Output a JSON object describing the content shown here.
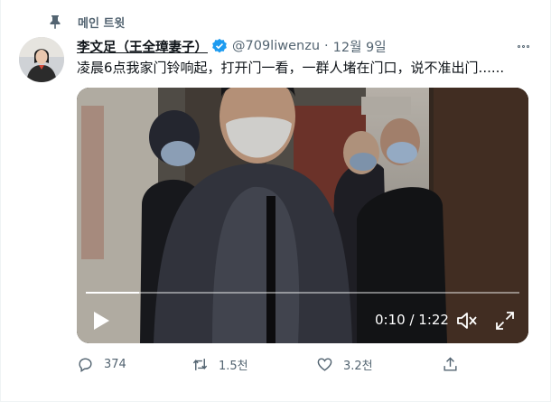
{
  "pinned": {
    "label": "메인 트윗",
    "icon": "pin-icon"
  },
  "author": {
    "display_name": "李文足（王全璋妻子）",
    "handle": "@709liwenzu",
    "separator": "·",
    "date": "12월 9일",
    "verified": true,
    "verified_icon": "verified-badge-icon"
  },
  "tweet": {
    "text": "凌晨6点我家门铃响起，打开门一看，一群人堵在门口，说不准出门......"
  },
  "video": {
    "time_display": "0:10 / 1:22",
    "progress_fraction": 0.122,
    "controls": [
      "play-icon",
      "volume-muted-icon",
      "fullscreen-icon"
    ]
  },
  "actions": {
    "reply_count": "374",
    "retweet_count": "1.5천",
    "like_count": "3.2천",
    "share_icon": "share-icon"
  },
  "colors": {
    "text_primary": "#0f1419",
    "text_secondary": "#536471",
    "verified_blue": "#1d9bf0"
  }
}
